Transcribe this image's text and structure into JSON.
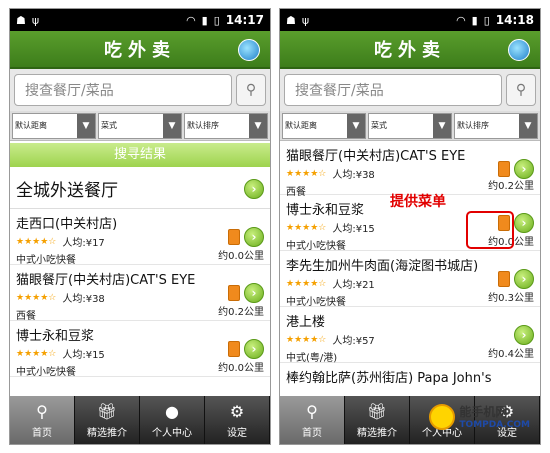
{
  "left": {
    "status_time": "14:17",
    "title": "吃外卖",
    "search_placeholder": "搜查餐厅/菜品",
    "filters": [
      "默认距离",
      "菜式",
      "默认排序"
    ],
    "result_bar": "搜寻结果",
    "section_label": "全城外送餐厅",
    "restaurants": [
      {
        "name": "走西口(中关村店)",
        "price": "人均:¥17",
        "category": "中式小吃快餐",
        "distance": "约0.0公里"
      },
      {
        "name": "猫眼餐厅(中关村店)CAT'S EYE",
        "price": "人均:¥38",
        "category": "西餐",
        "distance": "约0.2公里"
      },
      {
        "name": "博士永和豆浆",
        "price": "人均:¥15",
        "category": "中式小吃快餐",
        "distance": "约0.0公里"
      }
    ],
    "tabs": [
      "首页",
      "精选推介",
      "个人中心",
      "设定"
    ]
  },
  "right": {
    "status_time": "14:18",
    "title": "吃外卖",
    "search_placeholder": "搜查餐厅/菜品",
    "filters": [
      "默认距离",
      "菜式",
      "默认排序"
    ],
    "callout": "提供菜单",
    "restaurants": [
      {
        "name": "猫眼餐厅(中关村店)CAT'S EYE",
        "price": "人均:¥38",
        "category": "西餐",
        "distance": "约0.2公里"
      },
      {
        "name": "博士永和豆浆",
        "price": "人均:¥15",
        "category": "中式小吃快餐",
        "distance": "约0.0公里"
      },
      {
        "name": "李先生加州牛肉面(海淀图书城店)",
        "price": "人均:¥21",
        "category": "中式小吃快餐",
        "distance": "约0.3公里"
      },
      {
        "name": "港上楼",
        "price": "人均:¥57",
        "category": "中式(粤/港)",
        "distance": "约0.4公里"
      },
      {
        "name": "棒约翰比萨(苏州街店) Papa John's",
        "price": "",
        "category": "",
        "distance": ""
      }
    ],
    "tabs": [
      "首页",
      "精选推介",
      "个人中心",
      "设定"
    ]
  },
  "watermark": {
    "line1": "能手机网",
    "line2": "TOMPDA.COM"
  },
  "colors": {
    "green": "#5a9e2c",
    "orange": "#f08a1d",
    "red": "#e20000"
  }
}
